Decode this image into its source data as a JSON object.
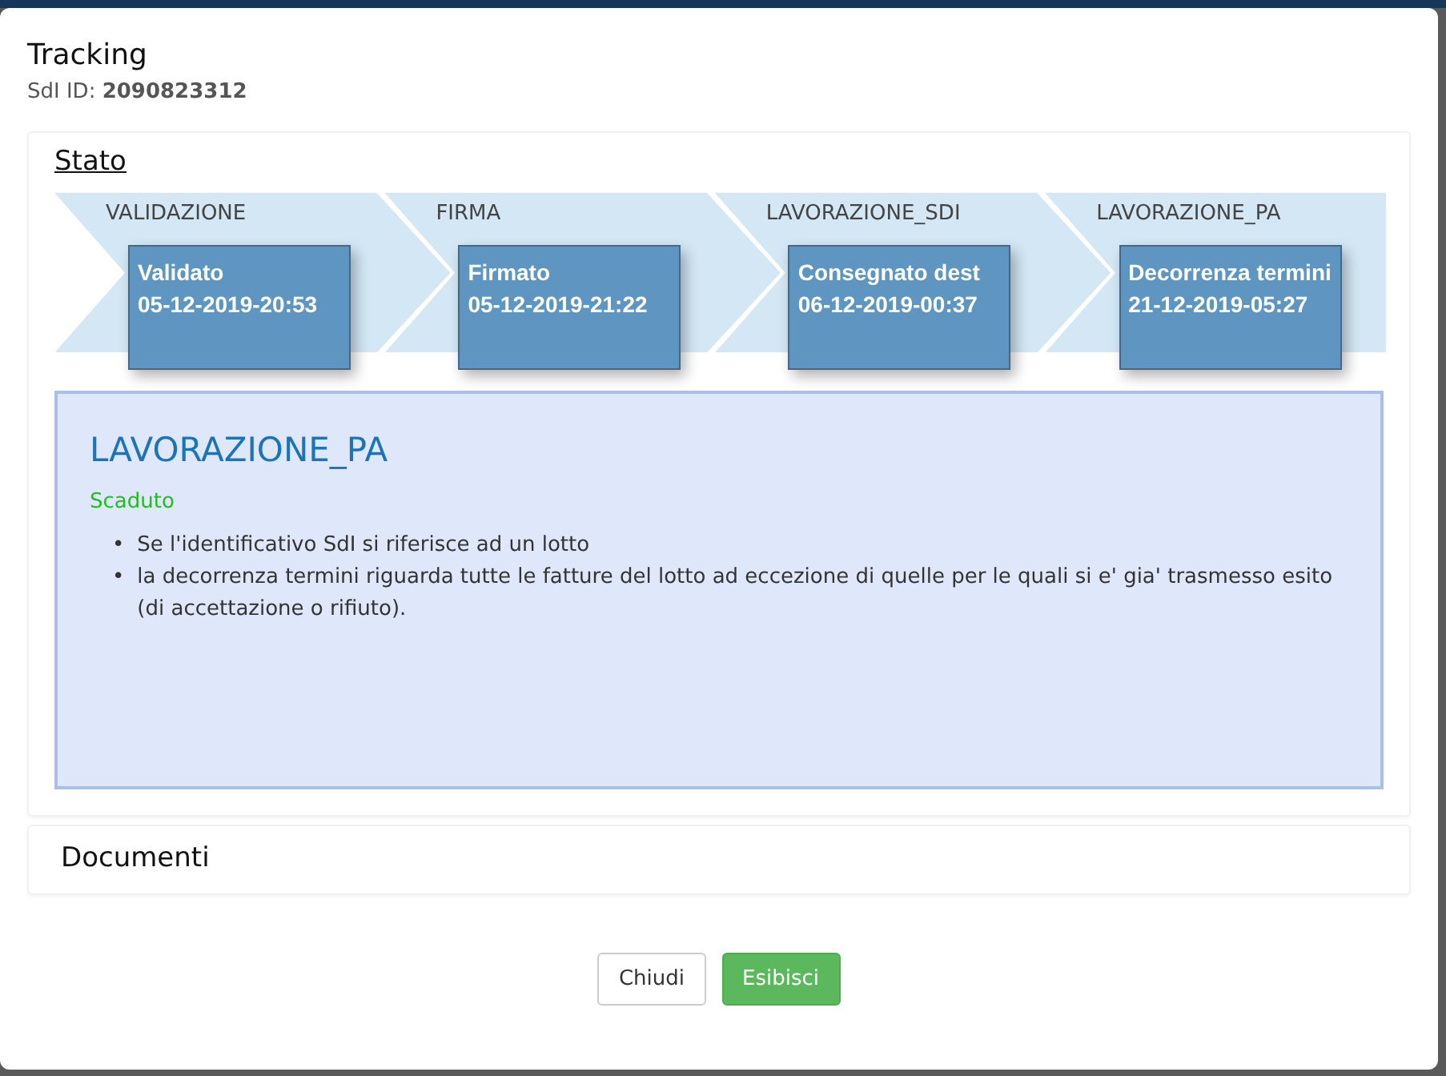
{
  "dialog": {
    "title": "Tracking",
    "id_label": "SdI ID:",
    "id_value": "2090823312"
  },
  "stato": {
    "heading": "Stato",
    "steps": [
      {
        "phase": "VALIDAZIONE",
        "status": "Validato",
        "date": "05-12-2019-20:53"
      },
      {
        "phase": "FIRMA",
        "status": "Firmato",
        "date": "05-12-2019-21:22"
      },
      {
        "phase": "LAVORAZIONE_SDI",
        "status": "Consegnato dest",
        "date": "06-12-2019-00:37"
      },
      {
        "phase": "LAVORAZIONE_PA",
        "status": "Decorrenza termini",
        "date": "21-12-2019-05:27"
      }
    ],
    "detail": {
      "title": "LAVORAZIONE_PA",
      "status": "Scaduto",
      "notes": [
        {
          "bullet": "•",
          "text": "Se l'identificativo SdI si riferisce ad un lotto"
        },
        {
          "bullet": "•",
          "text": "la decorrenza termini riguarda tutte le fatture del lotto ad eccezione di quelle per le quali si e' gia' trasmesso esito (di accettazione o rifiuto)."
        }
      ]
    }
  },
  "documenti": {
    "heading": "Documenti"
  },
  "buttons": [
    {
      "label": "Chiudi",
      "kind": "secondary"
    },
    {
      "label": "Esibisci",
      "kind": "primary"
    }
  ]
}
